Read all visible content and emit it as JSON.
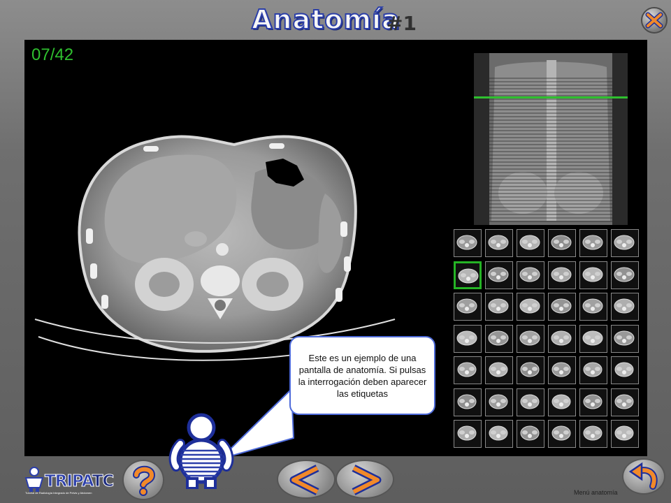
{
  "header": {
    "title": "Anatomía",
    "number": "#1"
  },
  "close_button": {
    "icon": "close-icon"
  },
  "viewer": {
    "counter": "07/42",
    "slice_current": 7,
    "slice_total": 42,
    "selected_thumbnail": 7,
    "thumbnail_rows": 7,
    "thumbnail_cols": 6,
    "accent_color": "#2fc02f"
  },
  "tooltip": {
    "text": "Este es un ejemplo de una pantalla de anatomía. Si pulsas la interrogación deben aparecer las etiquetas"
  },
  "footer": {
    "logo_main": "TRIPA",
    "logo_tc": "TC",
    "logo_sub": "Tutorial de Radiología Integrado de Pelvis y Abdomen",
    "menu_label": "Menú anatomía",
    "buttons": {
      "help": "question-icon",
      "prev": "arrow-left-icon",
      "next": "arrow-right-icon",
      "back": "return-icon"
    }
  }
}
